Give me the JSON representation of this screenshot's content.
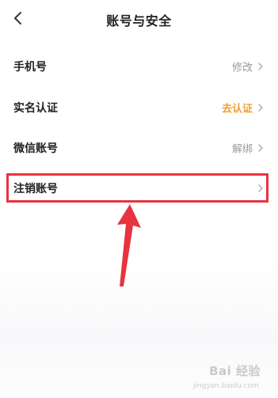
{
  "header": {
    "title": "账号与安全"
  },
  "rows": [
    {
      "label": "手机号",
      "value": "修改"
    },
    {
      "label": "实名认证",
      "value": "去认证"
    },
    {
      "label": "微信账号",
      "value": "解绑"
    },
    {
      "label": "注销账号",
      "value": ""
    }
  ],
  "colors": {
    "accent": "#f0a030",
    "highlight": "#e8333f",
    "muted": "#9a9a9a"
  },
  "watermark": {
    "main": "Bai 经验",
    "sub": "jingyan.baidu.com"
  },
  "icons": {
    "back": "back-chevron-icon",
    "row_arrow": "chevron-right-icon"
  }
}
